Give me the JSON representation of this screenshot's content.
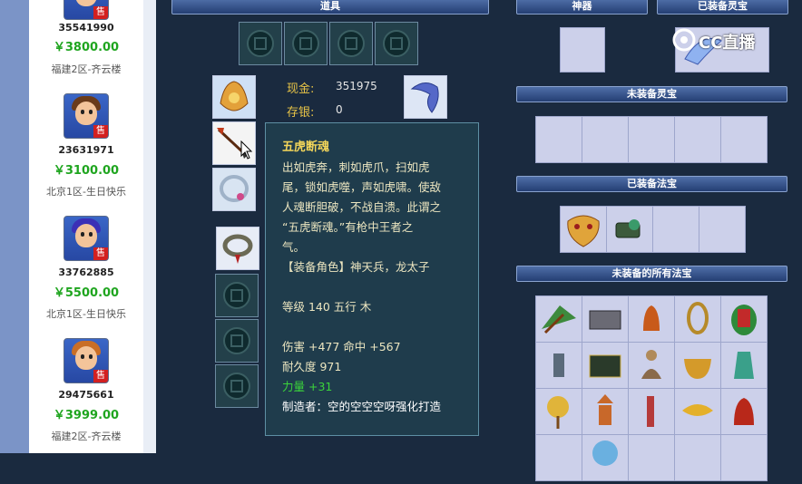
{
  "listings": [
    {
      "id": "35541990",
      "price": "￥3800.00",
      "server": "福建2区-齐云楼"
    },
    {
      "id": "23631971",
      "price": "￥3100.00",
      "server": "北京1区-生日快乐"
    },
    {
      "id": "33762885",
      "price": "￥5500.00",
      "server": "北京1区-生日快乐"
    },
    {
      "id": "29475661",
      "price": "￥3999.00",
      "server": "福建2区-齐云楼"
    }
  ],
  "sell_badge": "售",
  "headers": {
    "items": "道具",
    "artifact": "神器",
    "equipped_spirit": "已装备灵宝",
    "unequipped_spirit": "未装备灵宝",
    "equipped_treasure": "已装备法宝",
    "unequipped_treasure": "未装备的所有法宝"
  },
  "money": {
    "cash_label": "现金:",
    "cash_value": "351975",
    "deposit_label": "存银:",
    "deposit_value": "0"
  },
  "tooltip": {
    "name": "五虎断魂",
    "desc": [
      "出如虎奔，刺如虎爪，扫如虎",
      "尾，锁如虎噬，声如虎啸。使敌",
      "人魂断胆破，不战自溃。此谓之",
      "“五虎断魂。”有枪中王者之",
      "气。"
    ],
    "role": "【装备角色】神天兵，龙太子",
    "level": "等级 140  五行 木",
    "damage": "伤害 +477  命中 +567",
    "durability": "耐久度 971",
    "strength": "力量 +31",
    "maker": "制造者：空的空空空呀强化打造"
  },
  "watermark": "CC直播",
  "colors": {
    "price": "#1fa51f",
    "header": "#2c4a85",
    "tooltip_title": "#f2d55a",
    "bg": "#1a2a3f"
  }
}
